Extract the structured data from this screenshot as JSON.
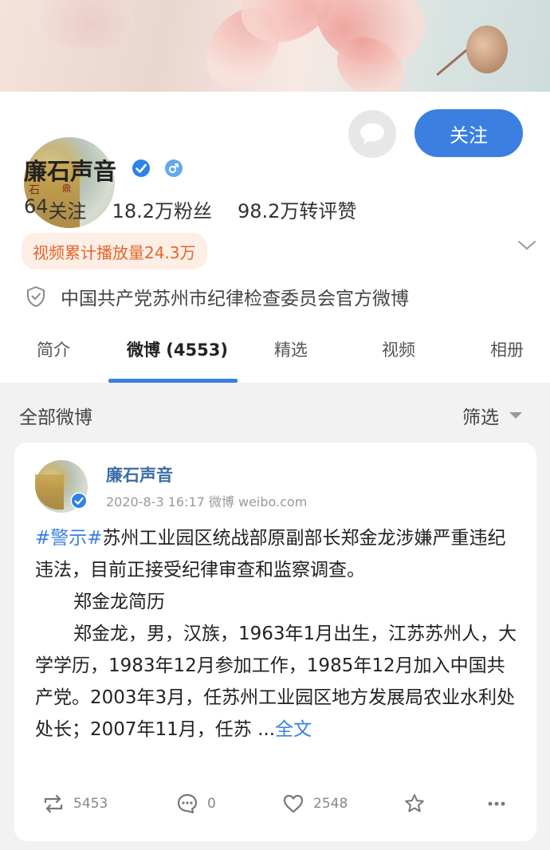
{
  "profile": {
    "name": "廉石声音",
    "follow_label": "关注",
    "stats": [
      {
        "value": "64",
        "label": "关注"
      },
      {
        "value": "18.2万",
        "label": "粉丝"
      },
      {
        "value": "98.2万",
        "label": "转评赞"
      }
    ],
    "video_badge": "视频累计播放量24.3万",
    "description": "中国共产党苏州市纪律检查委员会官方微博"
  },
  "tabs": [
    {
      "label": "简介",
      "active": false
    },
    {
      "label": "微博 (4553)",
      "active": true
    },
    {
      "label": "精选",
      "active": false
    },
    {
      "label": "视频",
      "active": false
    },
    {
      "label": "相册",
      "active": false
    }
  ],
  "section": {
    "title": "全部微博",
    "filter_label": "筛选"
  },
  "post": {
    "author": "廉石声音",
    "meta": "2020-8-3 16:17  微博 weibo.com",
    "hashtag": "#警示#",
    "headline": "苏州工业园区统战部原副部长郑金龙涉嫌严重违纪违法，目前正接受纪律审查和监察调查。",
    "subtitle": "郑金龙简历",
    "body": "郑金龙，男，汉族，1963年1月出生，江苏苏州人，大学学历，1983年12月参加工作，1985年12月加入中国共产党。2003年3月，任苏州工业园区地方发展局农业水利处处长；2007年11月，任苏 ...",
    "more_label": "全文",
    "reposts": "5453",
    "comments": "0",
    "likes": "2548"
  },
  "colors": {
    "accent": "#3b7fe0",
    "badge_text": "#e3672a",
    "badge_bg": "#fdeee6"
  },
  "icons": [
    "message-icon",
    "verified-badge-icon",
    "male-gender-icon",
    "chevron-down-icon",
    "shield-icon",
    "caret-down-icon",
    "repost-icon",
    "comment-icon",
    "like-icon",
    "favorite-star-icon",
    "more-icon"
  ]
}
